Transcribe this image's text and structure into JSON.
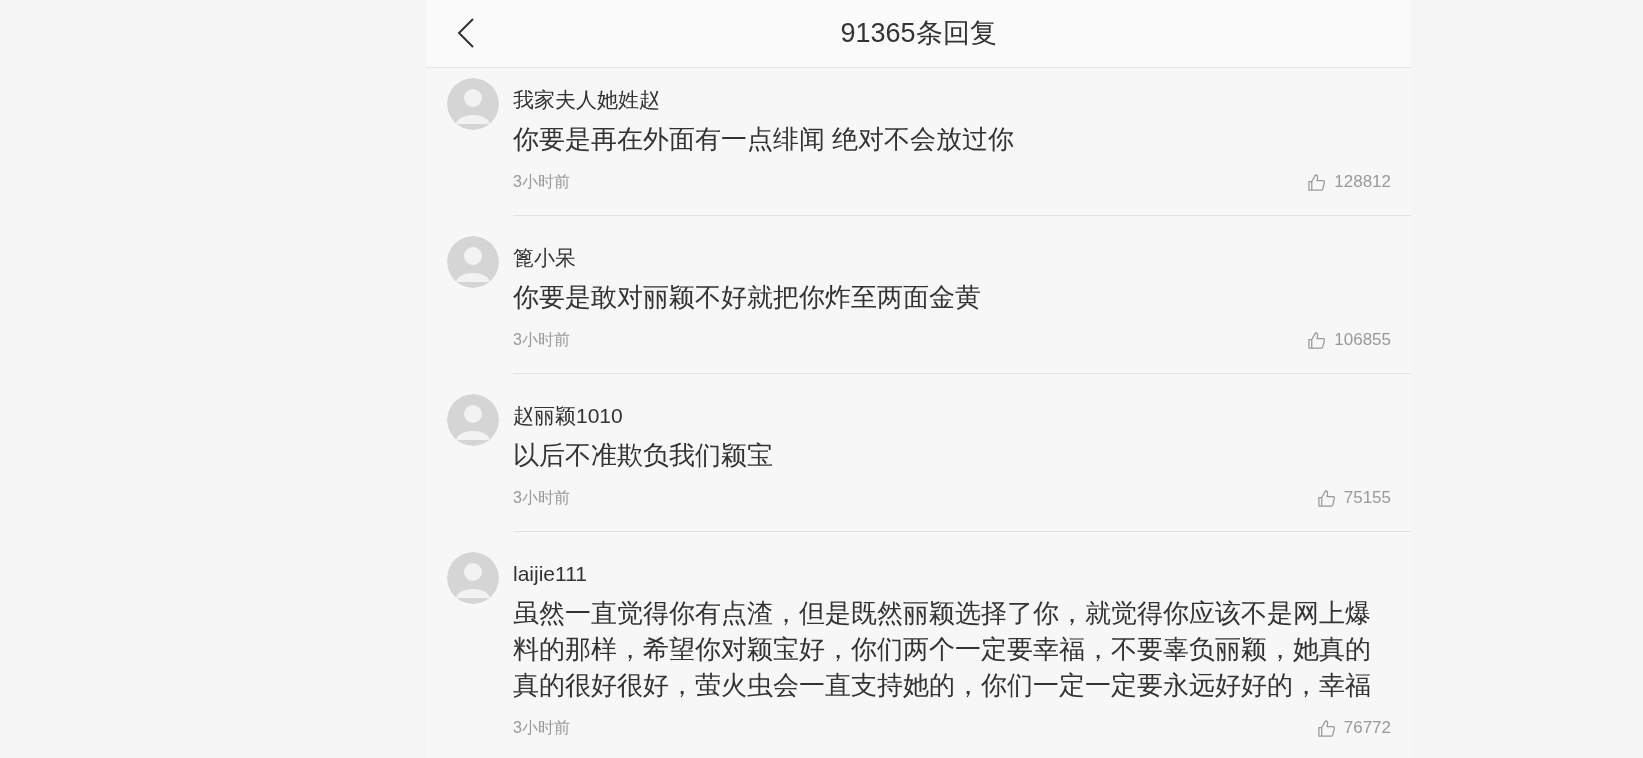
{
  "header": {
    "title": "91365条回复"
  },
  "comments": [
    {
      "user": "我家夫人她姓赵",
      "text": "你要是再在外面有一点绯闻 绝对不会放过你",
      "time": "3小时前",
      "likes": "128812"
    },
    {
      "user": "篦小呆",
      "text": "你要是敢对丽颖不好就把你炸至两面金黄",
      "time": "3小时前",
      "likes": "106855"
    },
    {
      "user": "赵丽颖1010",
      "text": "以后不准欺负我们颖宝",
      "time": "3小时前",
      "likes": "75155"
    },
    {
      "user": "laijie111",
      "text": "虽然一直觉得你有点渣，但是既然丽颖选择了你，就觉得你应该不是网上爆料的那样，希望你对颖宝好，你们两个一定要幸福，不要辜负丽颖，她真的真的很好很好，萤火虫会一直支持她的，你们一定一定要永远好好的，幸福",
      "time": "3小时前",
      "likes": "76772"
    }
  ]
}
